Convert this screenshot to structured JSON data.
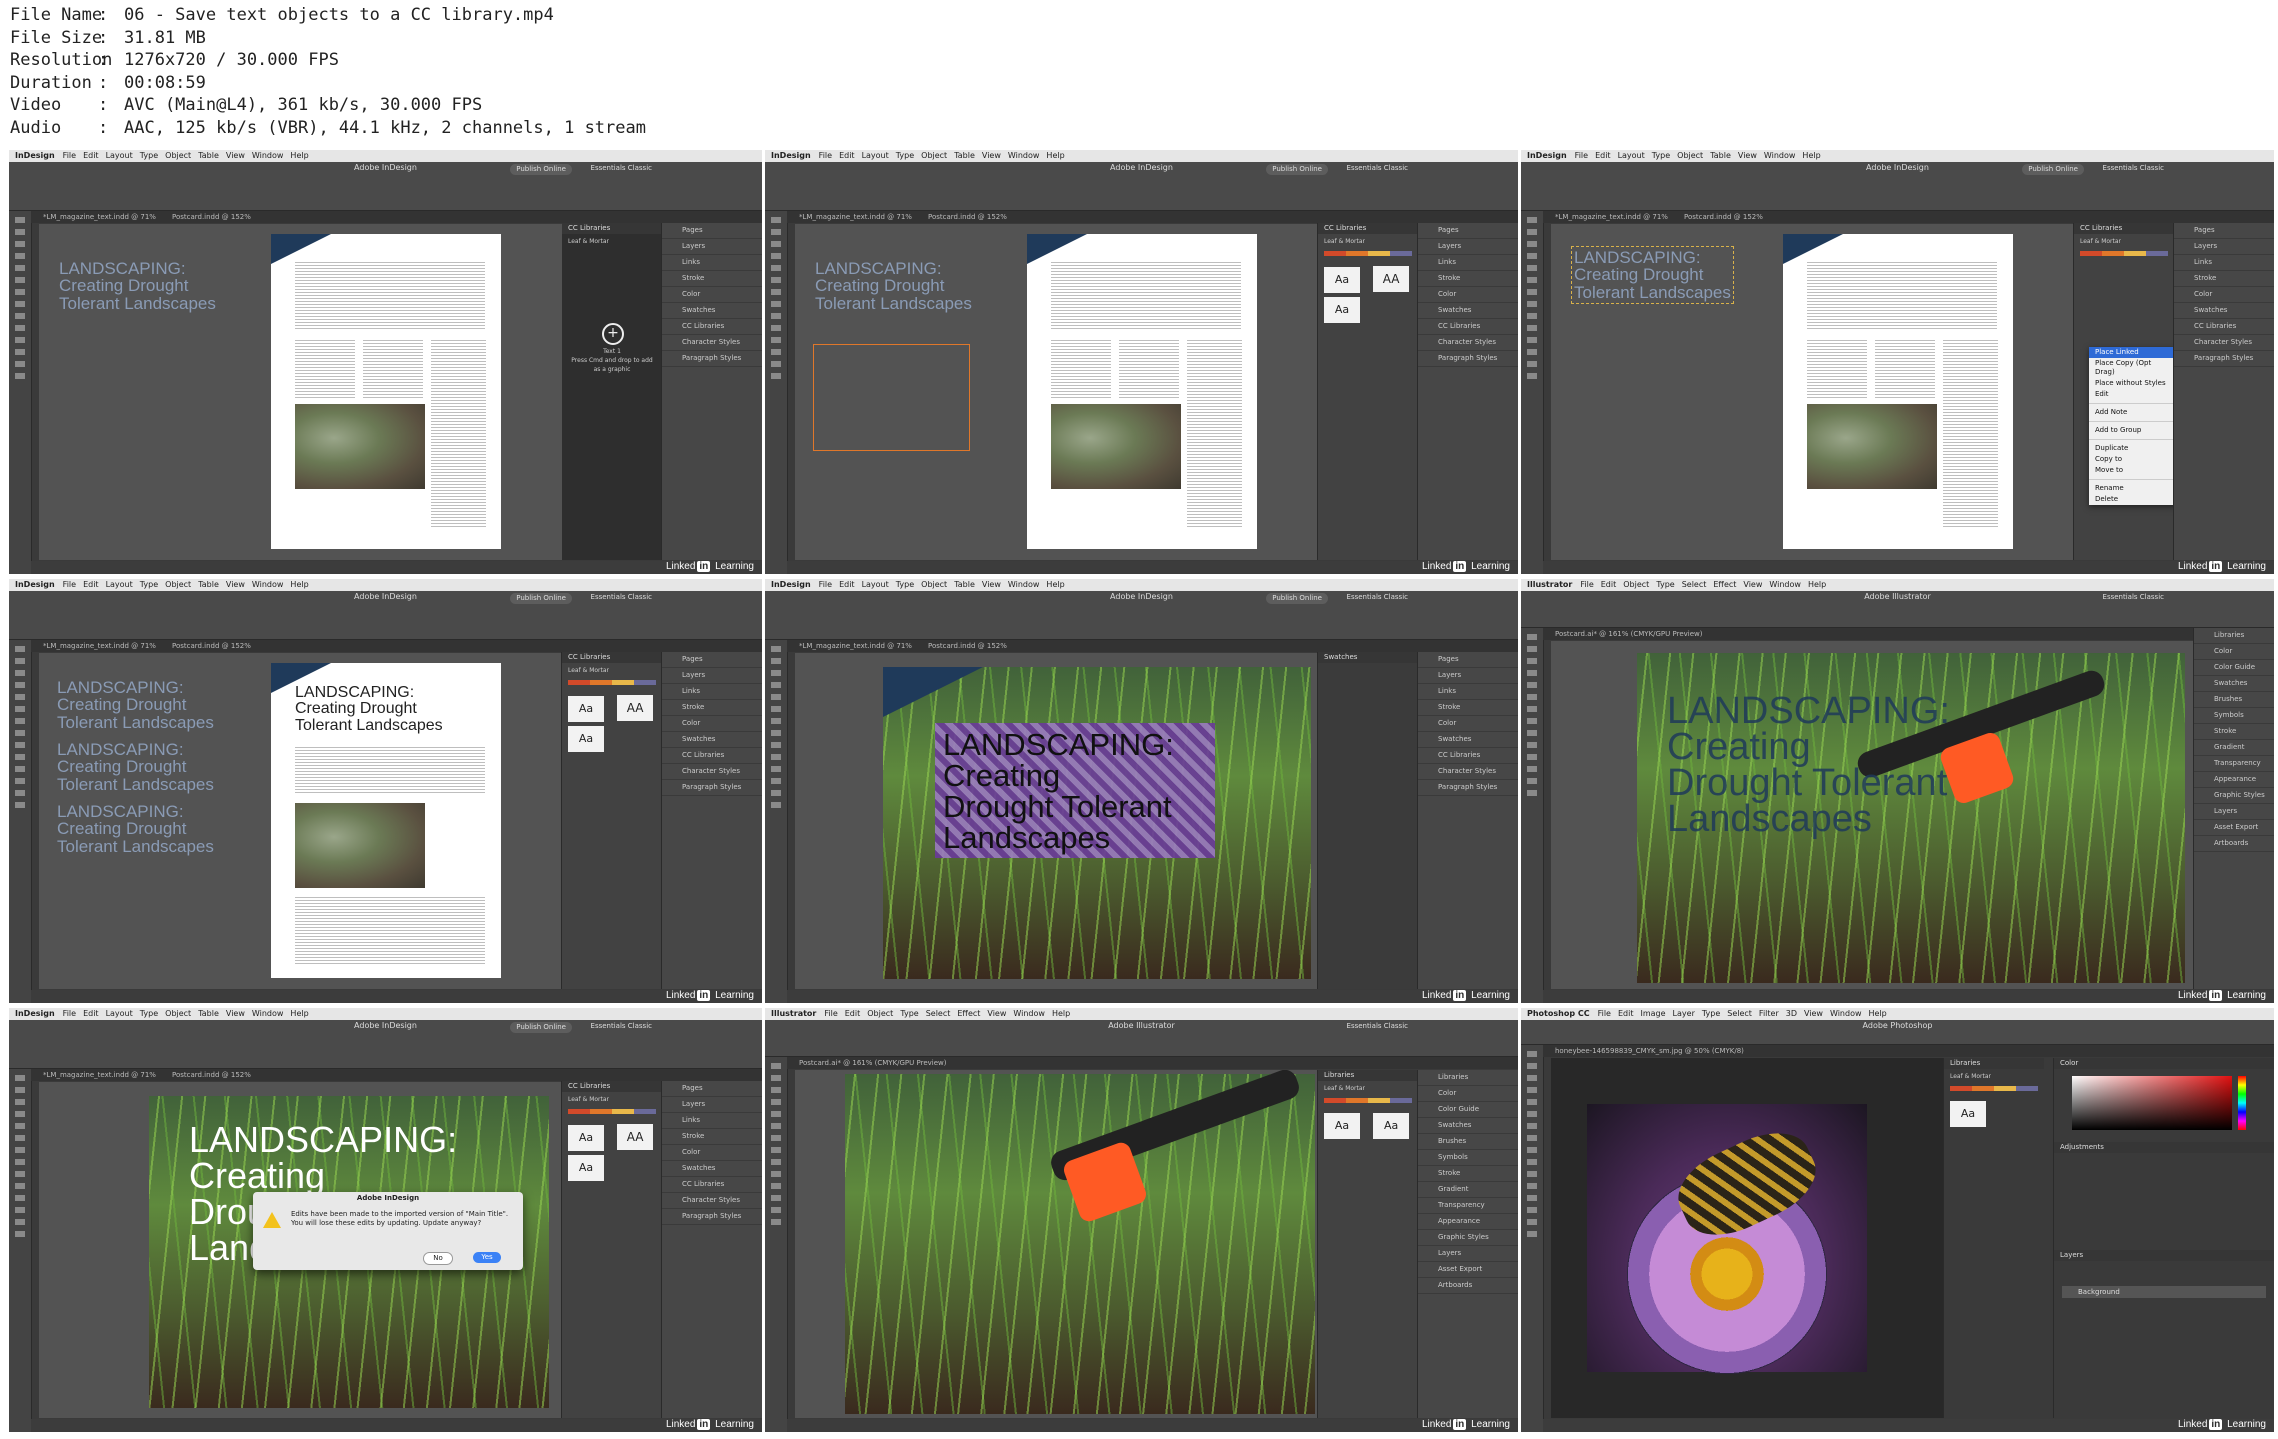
{
  "file_info": [
    {
      "key": "File Name",
      "value": "06 - Save text objects to a CC library.mp4"
    },
    {
      "key": "File Size",
      "value": "31.81 MB"
    },
    {
      "key": "Resolution",
      "value": "1276x720 / 30.000 FPS"
    },
    {
      "key": "Duration",
      "value": "00:08:59"
    },
    {
      "key": "Video",
      "value": "AVC (Main@L4), 361 kb/s, 30.000 FPS"
    },
    {
      "key": "Audio",
      "value": "AAC, 125 kb/s (VBR), 44.1 kHz, 2 channels, 1 stream"
    }
  ],
  "watermark": {
    "pre": "Linked",
    "in": "in",
    "post": " Learning"
  },
  "headline_text": "LANDSCAPING:\nCreating Drought\nTolerant Landscapes",
  "headline_big": "LANDSCAPING:\nCreating\nDrought Tolerant\nLandscapes",
  "thumbs": [
    {
      "app": "InDesign",
      "menu": [
        "File",
        "Edit",
        "Layout",
        "Type",
        "Object",
        "Table",
        "View",
        "Window",
        "Help"
      ],
      "title": "Adobe InDesign",
      "publish": "Publish Online",
      "workspace": "Essentials Classic",
      "tabs": [
        "*LM_magazine_text.indd @ 71%",
        "Postcard.indd @ 152%"
      ],
      "panels": [
        "Pages",
        "Layers",
        "Links",
        "Stroke",
        "Color",
        "Swatches",
        "CC Libraries",
        "Character Styles",
        "Paragraph Styles"
      ],
      "cc_title": "CC Libraries",
      "lib_name": "Leaf & Mortar"
    },
    {
      "app": "InDesign",
      "menu": [
        "File",
        "Edit",
        "Layout",
        "Type",
        "Object",
        "Table",
        "View",
        "Window",
        "Help"
      ],
      "title": "Adobe InDesign",
      "publish": "Publish Online",
      "workspace": "Essentials Classic"
    },
    {
      "app": "InDesign",
      "menu": [
        "File",
        "Edit",
        "Layout",
        "Type",
        "Object",
        "Table",
        "View",
        "Window",
        "Help"
      ],
      "title": "Adobe InDesign",
      "publish": "Publish Online",
      "workspace": "Essentials Classic"
    },
    {
      "app": "InDesign",
      "menu": [
        "File",
        "Edit",
        "Layout",
        "Type",
        "Object",
        "Table",
        "View",
        "Window",
        "Help"
      ],
      "title": "Adobe InDesign",
      "publish": "Publish Online",
      "workspace": "Essentials Classic"
    },
    {
      "app": "InDesign",
      "menu": [
        "File",
        "Edit",
        "Layout",
        "Type",
        "Object",
        "Table",
        "View",
        "Window",
        "Help"
      ],
      "title": "Adobe InDesign",
      "publish": "Publish Online",
      "workspace": "Essentials Classic"
    },
    {
      "app": "Illustrator",
      "menu": [
        "File",
        "Edit",
        "Object",
        "Type",
        "Select",
        "Effect",
        "View",
        "Window",
        "Help"
      ],
      "title": "Adobe Illustrator",
      "workspace": "Essentials Classic",
      "tab": "Postcard.ai* @ 161% (CMYK/GPU Preview)"
    },
    {
      "app": "InDesign",
      "menu": [
        "File",
        "Edit",
        "Layout",
        "Type",
        "Object",
        "Table",
        "View",
        "Window",
        "Help"
      ],
      "title": "Adobe InDesign",
      "publish": "Publish Online",
      "workspace": "Essentials Classic"
    },
    {
      "app": "Illustrator",
      "menu": [
        "File",
        "Edit",
        "Object",
        "Type",
        "Select",
        "Effect",
        "View",
        "Window",
        "Help"
      ],
      "title": "Adobe Illustrator",
      "workspace": "Essentials Classic",
      "tab": "Postcard.ai* @ 161% (CMYK/GPU Preview)"
    },
    {
      "app": "Photoshop CC",
      "menu": [
        "File",
        "Edit",
        "Image",
        "Layer",
        "Type",
        "Select",
        "Filter",
        "3D",
        "View",
        "Window",
        "Help"
      ],
      "title": "Adobe Photoshop",
      "tab": "honeybee-146598839_CMYK_sm.jpg @ 50% (CMYK/8)"
    }
  ],
  "dropzone": {
    "label": "Text 1",
    "hint": "Press Cmd and drop to add as a graphic"
  },
  "context_menu": [
    "Place Linked",
    "Place Copy (Opt Drag)",
    "Place without Styles",
    "Edit",
    "Add Note",
    "Add to Group",
    "Duplicate",
    "Copy to",
    "Move to",
    "Rename",
    "Delete"
  ],
  "dialog": {
    "title": "Adobe InDesign",
    "message": "Edits have been made to the imported version of \"Main Title\". You will lose these edits by updating. Update anyway?",
    "no": "No",
    "yes": "Yes"
  },
  "tile_aa": "Aa",
  "tile_AA": "AA",
  "colors": {
    "orange": "#e0772a",
    "navy": "#1f3a5a",
    "purple": "#6a3a9a"
  }
}
